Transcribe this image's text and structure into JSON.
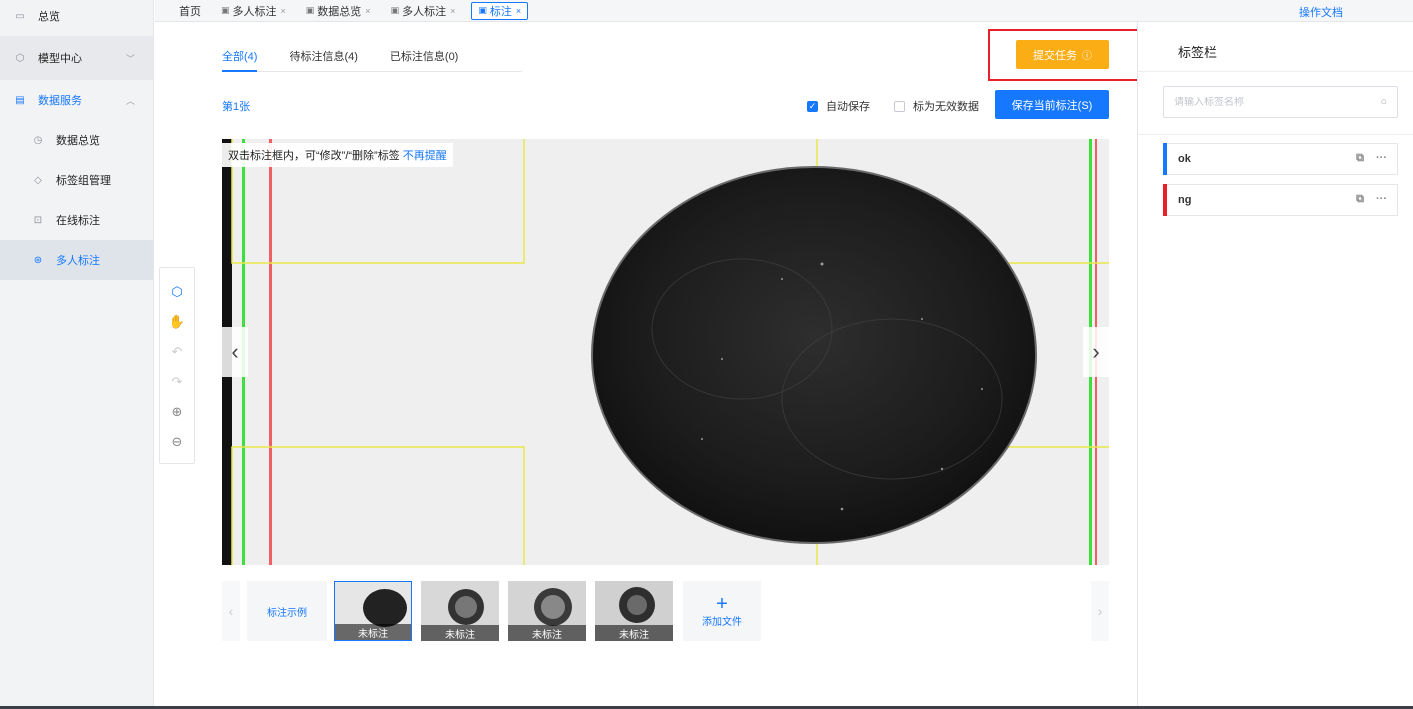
{
  "sidebar": {
    "items": [
      {
        "label": "总览",
        "icon": "dashboard-icon"
      },
      {
        "label": "模型中心",
        "icon": "cube-icon"
      },
      {
        "label": "数据服务",
        "icon": "database-icon"
      },
      {
        "label": "数据总览",
        "icon": "clock-icon"
      },
      {
        "label": "标签组管理",
        "icon": "tag-icon"
      },
      {
        "label": "在线标注",
        "icon": "annotate-icon"
      },
      {
        "label": "多人标注",
        "icon": "team-icon"
      }
    ]
  },
  "tabbar": {
    "home": "首页",
    "tabs": [
      {
        "label": "多人标注",
        "close": "×"
      },
      {
        "label": "数据总览",
        "close": "×"
      },
      {
        "label": "多人标注",
        "close": "×"
      },
      {
        "label": "标注",
        "close": "×"
      }
    ],
    "docs": "操作文档"
  },
  "subtabs": [
    "全部(4)",
    "待标注信息(4)",
    "已标注信息(0)"
  ],
  "actions": {
    "submit": "提交任务",
    "submit_info": "ⓘ",
    "page_no": "第1张",
    "auto_save": "自动保存",
    "invalid": "标为无效数据",
    "save": "保存当前标注(S)"
  },
  "canvas": {
    "hint": "双击标注框内，可“修改”/“删除”标签",
    "hint_link": "不再提醒",
    "prev": "‹",
    "next": "›"
  },
  "thumbs": {
    "example": "标注示例",
    "items": [
      "未标注",
      "未标注",
      "未标注",
      "未标注"
    ],
    "add": "添加文件",
    "add_plus": "+",
    "prev": "‹",
    "next": "›"
  },
  "right": {
    "title": "标签栏",
    "search_placeholder": "请输入标签名称",
    "labels": [
      {
        "name": "ok",
        "color": "#1677ff"
      },
      {
        "name": "ng",
        "color": "#e8202a"
      }
    ]
  }
}
